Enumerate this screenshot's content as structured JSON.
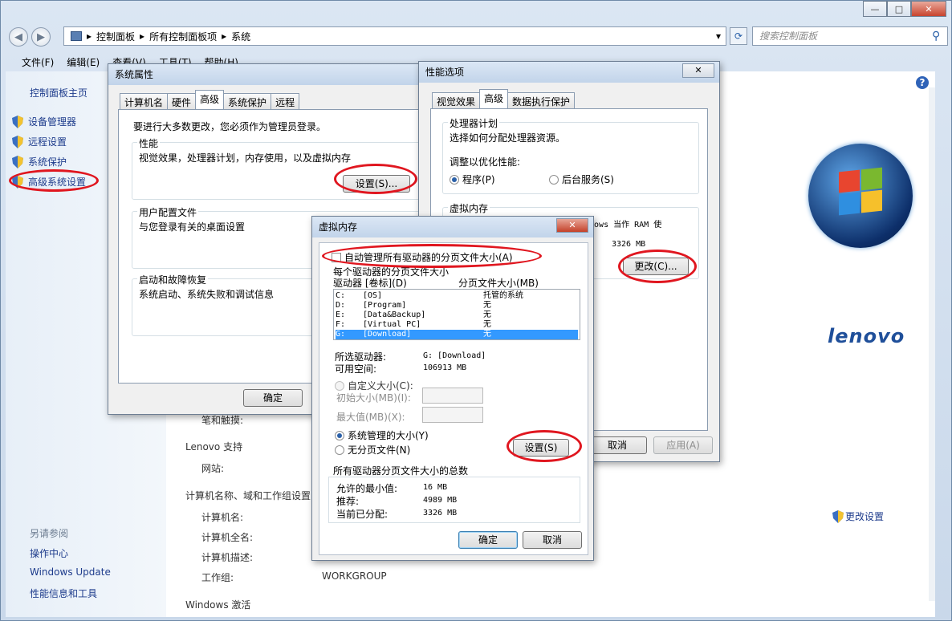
{
  "window": {
    "minimize": "—",
    "maximize": "□",
    "close": "✕"
  },
  "nav": {
    "back": "◀",
    "forward": "▶",
    "breadcrumb": [
      "控制面板",
      "所有控制面板项",
      "系统"
    ],
    "search_placeholder": "搜索控制面板",
    "refresh_icon": "refresh-icon"
  },
  "menu": [
    "文件(F)",
    "编辑(E)",
    "查看(V)",
    "工具(T)",
    "帮助(H)"
  ],
  "sidebar": {
    "home": "控制面板主页",
    "items": [
      "设备管理器",
      "远程设置",
      "系统保护",
      "高级系统设置"
    ],
    "see_also_title": "另请参阅",
    "see_also": [
      "操作中心",
      "Windows Update",
      "性能信息和工具"
    ]
  },
  "content": {
    "pen_touch": "笔和触摸:",
    "lenovo_support": "Lenovo 支持",
    "website": "网站:",
    "computer_section": "计算机名称、域和工作组设置",
    "computer_name": "计算机名:",
    "full_name": "计算机全名:",
    "description": "计算机描述:",
    "workgroup_label": "工作组:",
    "workgroup_value": "WORKGROUP",
    "change_settings": "更改设置",
    "activation": "Windows 激活",
    "brand": "lenovo"
  },
  "sysprops": {
    "title": "系统属性",
    "tabs": [
      "计算机名",
      "硬件",
      "高级",
      "系统保护",
      "远程"
    ],
    "admin_note": "要进行大多数更改，您必须作为管理员登录。",
    "perf_title": "性能",
    "perf_desc": "视觉效果，处理器计划，内存使用，以及虚拟内存",
    "perf_btn": "设置(S)...",
    "profile_title": "用户配置文件",
    "profile_desc": "与您登录有关的桌面设置",
    "startup_title": "启动和故障恢复",
    "startup_desc": "系统启动、系统失败和调试信息",
    "ok": "确定"
  },
  "perfopts": {
    "title": "性能选项",
    "tabs": [
      "视觉效果",
      "高级",
      "数据执行保护"
    ],
    "sched_title": "处理器计划",
    "sched_desc": "选择如何分配处理器资源。",
    "adjust": "调整以优化性能:",
    "programs": "程序(P)",
    "background": "后台服务(S)",
    "vm_title": "虚拟内存",
    "vm_desc": "ndows 当作 RAM 使",
    "vm_size": "3326 MB",
    "change_btn": "更改(C)...",
    "cancel": "取消",
    "apply": "应用(A)"
  },
  "vmem": {
    "title": "虚拟内存",
    "auto_label": "自动管理所有驱动器的分页文件大小(A)",
    "per_drive": "每个驱动器的分页文件大小",
    "col_drive": "驱动器 [卷标](D)",
    "col_size": "分页文件大小(MB)",
    "drives": [
      {
        "d": "C:",
        "l": "[OS]",
        "s": "托管的系统"
      },
      {
        "d": "D:",
        "l": "[Program]",
        "s": "无"
      },
      {
        "d": "E:",
        "l": "[Data&Backup]",
        "s": "无"
      },
      {
        "d": "F:",
        "l": "[Virtual PC]",
        "s": "无"
      },
      {
        "d": "G:",
        "l": "[Download]",
        "s": "无"
      }
    ],
    "sel_drive_label": "所选驱动器:",
    "sel_drive_value": "G:  [Download]",
    "free_label": "可用空间:",
    "free_value": "106913 MB",
    "custom": "自定义大小(C):",
    "initial": "初始大小(MB)(I):",
    "max": "最大值(MB)(X):",
    "system_managed": "系统管理的大小(Y)",
    "no_paging": "无分页文件(N)",
    "set_btn": "设置(S)",
    "totals_title": "所有驱动器分页文件大小的总数",
    "min_label": "允许的最小值:",
    "min_value": "16 MB",
    "rec_label": "推荐:",
    "rec_value": "4989 MB",
    "cur_label": "当前已分配:",
    "cur_value": "3326 MB",
    "ok": "确定",
    "cancel": "取消"
  },
  "colors": {
    "accent": "#1e3c8c",
    "highlight": "#3399ff",
    "annotation": "#e0161f"
  }
}
